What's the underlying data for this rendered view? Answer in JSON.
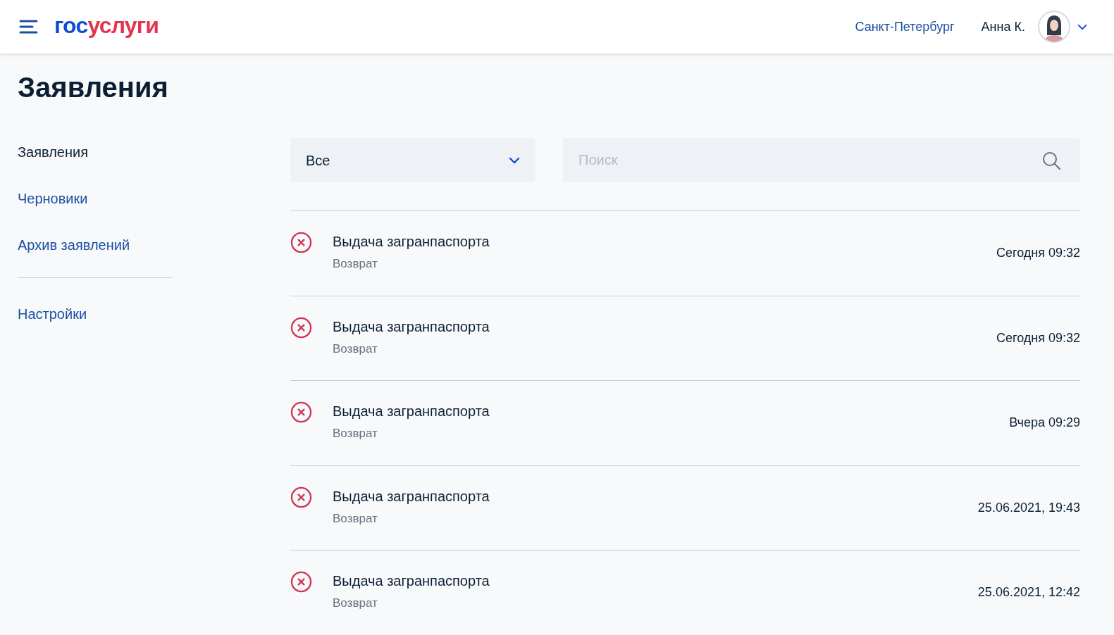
{
  "header": {
    "logo": {
      "first": "гос",
      "second": "услуги"
    },
    "city": "Санкт-Петербург",
    "user": "Анна К."
  },
  "title": "Заявления",
  "sidebar": {
    "items": [
      {
        "label": "Заявления",
        "selected": true
      },
      {
        "label": "Черновики",
        "selected": false
      },
      {
        "label": "Архив заявлений",
        "selected": false
      }
    ],
    "bottom_items": [
      {
        "label": "Настройки",
        "selected": false
      }
    ]
  },
  "filter": {
    "value": "Все"
  },
  "search": {
    "placeholder": "Поиск"
  },
  "applications": [
    {
      "title": "Выдача загранпаспорта",
      "status": "Возврат",
      "date": "Сегодня 09:32"
    },
    {
      "title": "Выдача загранпаспорта",
      "status": "Возврат",
      "date": "Сегодня 09:32"
    },
    {
      "title": "Выдача загранпаспорта",
      "status": "Возврат",
      "date": "Вчера 09:29"
    },
    {
      "title": "Выдача загранпаспорта",
      "status": "Возврат",
      "date": "25.06.2021, 19:43"
    },
    {
      "title": "Выдача загранпаспорта",
      "status": "Возврат",
      "date": "25.06.2021, 12:42"
    }
  ]
}
